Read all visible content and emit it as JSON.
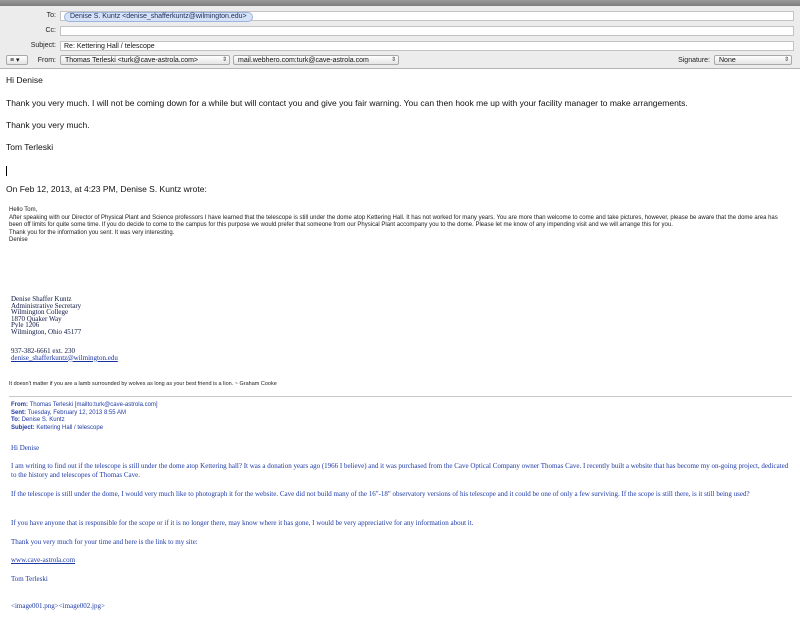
{
  "header": {
    "to_label": "To:",
    "to_recipient": "Denise S. Kuntz <denise_shafferkuntz@wilmington.edu>",
    "cc_label": "Cc:",
    "cc_value": "",
    "subject_label": "Subject:",
    "subject_value": "Re: Kettering Hall / telescope",
    "from_label": "From:",
    "from_account": "Thomas Terleski <turk@cave-astrola.com>",
    "smtp_server": "mail.webhero.com:turk@cave-astrola.com",
    "signature_label": "Signature:",
    "signature_value": "None",
    "options_label": "≡ ▾"
  },
  "reply": {
    "greeting": "Hi Denise",
    "line1": "Thank you very much.  I will not be coming down for a while but will contact you and give you fair warning.  You can then hook me up with your facility manager to make arrangements.",
    "line2": "Thank you very much.",
    "signoff": "Tom Terleski",
    "attribution": "On Feb 12, 2013, at 4:23 PM, Denise S. Kuntz wrote:"
  },
  "quoted": {
    "hello": "Hello Tom,",
    "para1": "After speaking with our Director of Physical Plant and Science professors I have learned that the telescope is still under the dome atop Kettering Hall.  It has not worked for many years.  You are more than welcome to come and take pictures, however, please be aware that the dome area has been off limits for quite some time.  If you do decide to come to the campus for this purpose we would prefer that someone from our Physical Plant accompany you to the dome.  Please let me know of any impending visit and we will arrange this for you.",
    "thanks": "Thank you for the information you sent.  It was very interesting.",
    "name": "Denise",
    "sig_name": "Denise Shaffer Kuntz",
    "sig_title": "Administrative Secretary",
    "sig_org": "Wilmington College",
    "sig_street": "1870 Quaker Way",
    "sig_box": "Pyle 1206",
    "sig_city": "Wilmington, Ohio 45177",
    "sig_phone": "937-382-6661 ext. 230",
    "sig_email": "denise_shafferkuntz@wilmington.edu",
    "quote_line": "It doesn't matter if you are a lamb surrounded by wolves as long as your best friend is a lion. ~ Graham Cooke"
  },
  "original": {
    "from_label": "From:",
    "from_value": "Thomas Terleski [mailto:turk@cave-astrola.com]",
    "sent_label": "Sent:",
    "sent_value": "Tuesday, February 12, 2013 8:55 AM",
    "to_label": "To:",
    "to_value": "Denise S. Kuntz",
    "subject_label": "Subject:",
    "subject_value": "Kettering Hall / telescope",
    "greeting": "Hi Denise",
    "para1": "I am writing to find out if the telescope is still under the dome atop Kettering hall?  It was a donation years ago (1966 I believe) and it was purchased from the Cave Optical Company owner Thomas Cave.  I recently built a website that has become my on-going project, dedicated to the history and telescopes of Thomas Cave.",
    "para2": "If the telescope is still under the dome, I would very much like to photograph it for the website.  Cave did not build many of the 16\"-18\" observatory versions of his telescope and it could be one of only a few surviving.  If the scope is still there, is it still being used?",
    "para3": "If you have anyone that is responsible for the scope or if it is no longer there, may know where it has gone, I would be very appreciative for any information about it.",
    "para4": "Thank you very much for your time and here is the link to my site:",
    "link": "www.cave-astrola.com",
    "signoff": "Tom Terleski",
    "attachments": "<image001.png><image002.jpg>"
  }
}
